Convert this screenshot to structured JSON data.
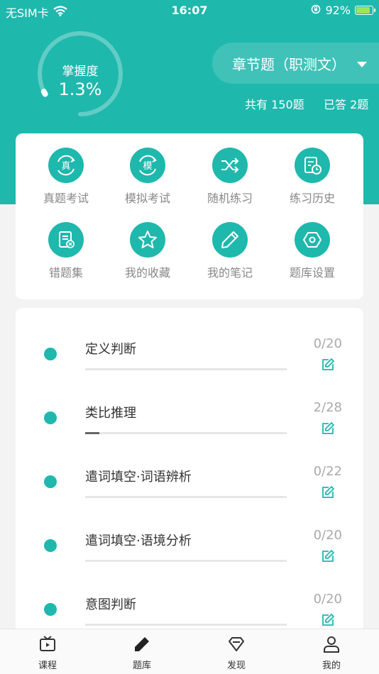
{
  "status": {
    "carrier": "无SIM卡",
    "time": "16:07",
    "battery": "92%",
    "battery_level": 0.92
  },
  "mastery": {
    "label": "掌握度",
    "value": "1.3%",
    "fraction": 0.013
  },
  "selector": {
    "label": "章节题（职测文）"
  },
  "stats": {
    "total": "共有 150题",
    "answered": "已答 2题"
  },
  "tools": [
    {
      "label": "真题考试",
      "icon": "real-exam-icon"
    },
    {
      "label": "模拟考试",
      "icon": "mock-exam-icon"
    },
    {
      "label": "随机练习",
      "icon": "shuffle-icon"
    },
    {
      "label": "练习历史",
      "icon": "history-icon"
    },
    {
      "label": "错题集",
      "icon": "wrong-questions-icon"
    },
    {
      "label": "我的收藏",
      "icon": "star-icon"
    },
    {
      "label": "我的笔记",
      "icon": "pencil-icon"
    },
    {
      "label": "题库设置",
      "icon": "settings-icon"
    }
  ],
  "chapters": [
    {
      "title": "定义判断",
      "count": "0/20",
      "progress": 0.0
    },
    {
      "title": "类比推理",
      "count": "2/28",
      "progress": 0.0714
    },
    {
      "title": "遣词填空·词语辨析",
      "count": "0/22",
      "progress": 0.0
    },
    {
      "title": "遣词填空·语境分析",
      "count": "0/20",
      "progress": 0.0
    },
    {
      "title": "意图判断",
      "count": "0/20",
      "progress": 0.0
    }
  ],
  "tabbar": [
    {
      "label": "课程",
      "icon": "tv-icon",
      "active": false
    },
    {
      "label": "题库",
      "icon": "pencil-icon",
      "active": true
    },
    {
      "label": "发现",
      "icon": "diamond-icon",
      "active": false
    },
    {
      "label": "我的",
      "icon": "user-icon",
      "active": false
    }
  ],
  "colors": {
    "accent": "#1fb8ad",
    "battery_fill": "#9be65a"
  }
}
